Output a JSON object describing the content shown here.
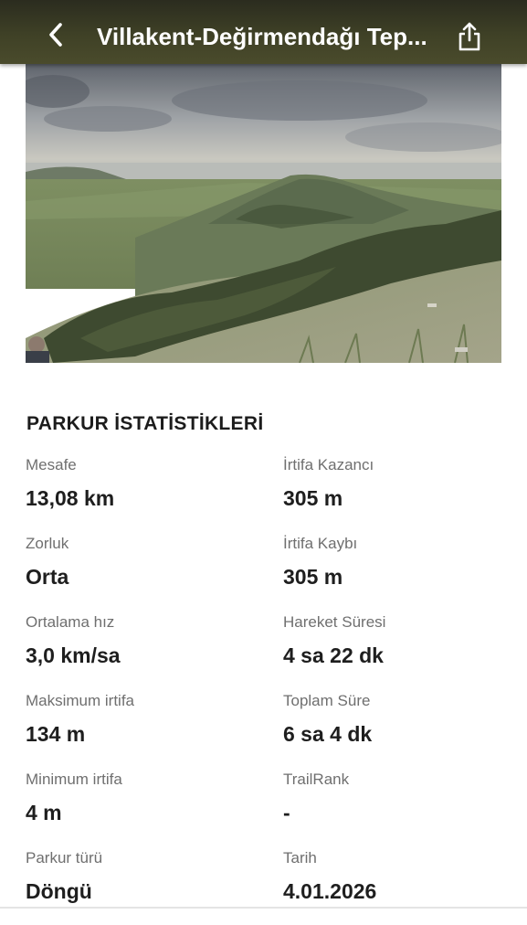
{
  "header": {
    "title": "Villakent-Değirmendağı Tep...",
    "back_icon": "chevron-left-icon",
    "share_icon": "share-icon",
    "background": "#3f4126"
  },
  "photo": {
    "description_icon": "trail-photo"
  },
  "stats_section": {
    "title": "PARKUR İSTATİSTİKLERİ",
    "rows": [
      {
        "left": {
          "label": "Mesafe",
          "value": "13,08 km"
        },
        "right": {
          "label": "İrtifa Kazancı",
          "value": "305 m"
        }
      },
      {
        "left": {
          "label": "Zorluk",
          "value": "Orta"
        },
        "right": {
          "label": "İrtifa Kaybı",
          "value": "305 m"
        }
      },
      {
        "left": {
          "label": "Ortalama hız",
          "value": "3,0 km/sa"
        },
        "right": {
          "label": "Hareket Süresi",
          "value": "4 sa 22 dk"
        }
      },
      {
        "left": {
          "label": "Maksimum irtifa",
          "value": "134 m"
        },
        "right": {
          "label": "Toplam Süre",
          "value": "6 sa 4 dk"
        }
      },
      {
        "left": {
          "label": "Minimum irtifa",
          "value": "4 m"
        },
        "right": {
          "label": "TrailRank",
          "value": "-"
        }
      },
      {
        "left": {
          "label": "Parkur türü",
          "value": "Döngü"
        },
        "right": {
          "label": "Tarih",
          "value": "4.01.2026"
        }
      }
    ]
  }
}
